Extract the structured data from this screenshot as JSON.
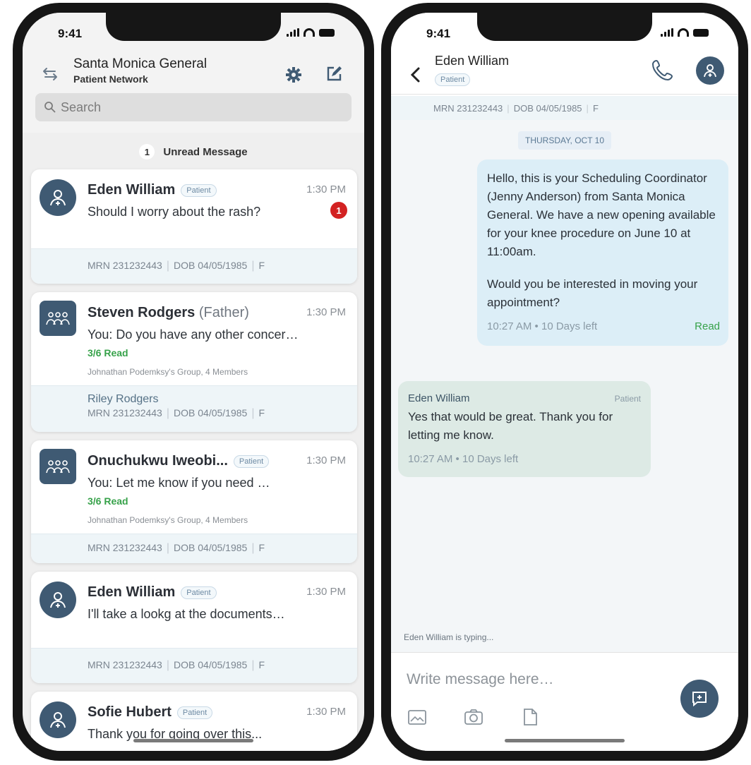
{
  "list_screen": {
    "status_time": "9:41",
    "header": {
      "title": "Santa Monica General",
      "subtitle": "Patient Network"
    },
    "search_placeholder": "Search",
    "unread": {
      "count": "1",
      "label": "Unread Message"
    },
    "cards": [
      {
        "name": "Eden William",
        "relation": "",
        "tag": "Patient",
        "time": "1:30 PM",
        "message": "Should I worry about the rash?",
        "badge": "1",
        "read": "",
        "group": "",
        "foot_name": "",
        "mrn": "MRN 231232443",
        "dob": "DOB 04/05/1985",
        "sex": "F"
      },
      {
        "name": "Steven Rodgers",
        "relation": "(Father)",
        "tag": "",
        "time": "1:30 PM",
        "message": "You: Do you have any other concer…",
        "badge": "",
        "read": "3/6 Read",
        "group": "Johnathan Podemksy's Group, 4 Members",
        "foot_name": "Riley Rodgers",
        "mrn": "MRN 231232443",
        "dob": "DOB 04/05/1985",
        "sex": "F"
      },
      {
        "name": "Onuchukwu Iweobi...",
        "relation": "",
        "tag": "Patient",
        "time": "1:30 PM",
        "message": "You: Let me know if you need …",
        "badge": "",
        "read": "3/6 Read",
        "group": "Johnathan Podemksy's Group, 4 Members",
        "foot_name": "",
        "mrn": "MRN 231232443",
        "dob": "DOB 04/05/1985",
        "sex": "F"
      },
      {
        "name": "Eden William",
        "relation": "",
        "tag": "Patient",
        "time": "1:30 PM",
        "message": "I'll take a lookg at the documents…",
        "badge": "",
        "read": "",
        "group": "",
        "foot_name": "",
        "mrn": "MRN 231232443",
        "dob": "DOB 04/05/1985",
        "sex": "F"
      },
      {
        "name": "Sofie Hubert",
        "relation": "",
        "tag": "Patient",
        "time": "1:30 PM",
        "message": "Thank you for going over this...",
        "badge": "",
        "read": "",
        "group": "",
        "foot_name": "",
        "mrn": "",
        "dob": "",
        "sex": ""
      }
    ]
  },
  "chat_screen": {
    "status_time": "9:41",
    "contact": {
      "name": "Eden William",
      "tag": "Patient"
    },
    "info_bar": {
      "mrn": "MRN 231232443",
      "dob": "DOB 04/05/1985",
      "sex": "F"
    },
    "day_label": "THURSDAY, OCT 10",
    "outgoing": {
      "para1": "Hello, this is your Scheduling Coordinator (Jenny Anderson) from Santa Monica General. We have a new opening available for your knee procedure on June 10 at 11:00am.",
      "para2": "Would you be interested in moving your appointment?",
      "time": "10:27 AM",
      "expiry": "10 Days left",
      "status": "Read"
    },
    "incoming": {
      "sender": "Eden William",
      "tag": "Patient",
      "text": "Yes that would be great. Thank you for letting me know.",
      "time": "10:27 AM",
      "expiry": "10 Days left"
    },
    "typing": "Eden William is typing...",
    "composer_placeholder": "Write message here…"
  },
  "colors": {
    "accent": "#3f5a73",
    "read_green": "#37a24a",
    "badge_red": "#d32222",
    "bubble_out": "#dceef7",
    "bubble_in": "#ddeae5"
  }
}
